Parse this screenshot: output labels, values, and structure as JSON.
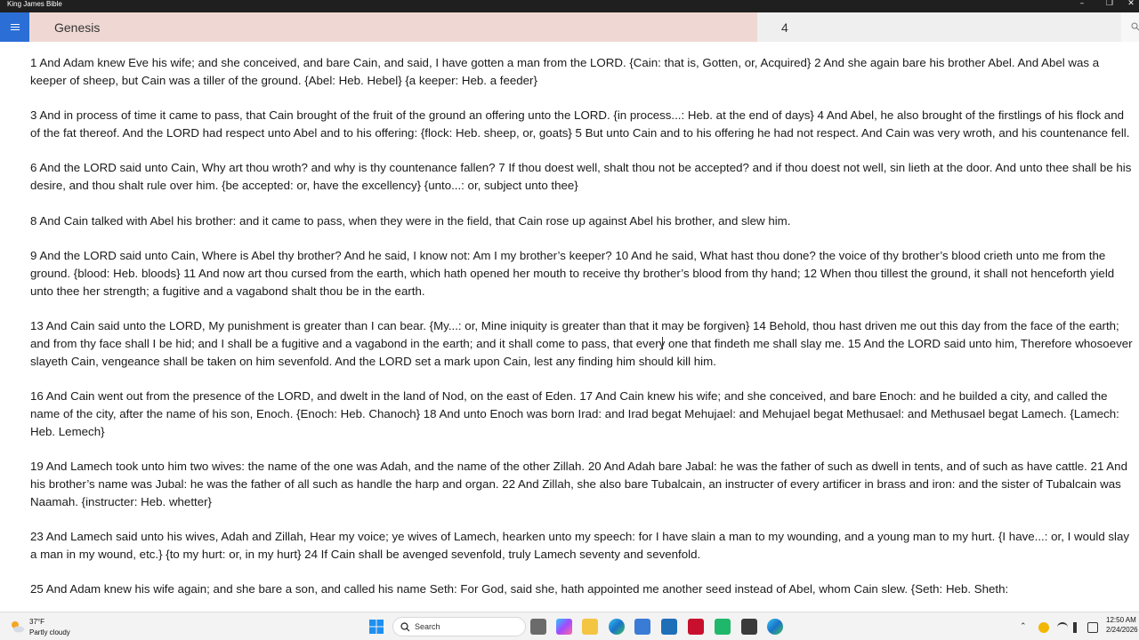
{
  "window": {
    "title": "King James Bible",
    "minimize": "–",
    "restore": "❐",
    "close": "✕"
  },
  "nav": {
    "menu_icon": "hamburger-menu-icon",
    "book": "Genesis",
    "chapter": "4",
    "search_icon": "search-icon"
  },
  "verses": [
    "1  And Adam knew Eve his wife; and she conceived, and bare Cain, and said, I have gotten a man from the LORD. {Cain: that is, Gotten, or, Acquired} 2  And she again bare his brother Abel. And Abel was a keeper of sheep, but Cain was a tiller of the ground. {Abel: Heb. Hebel} {a keeper: Heb. a feeder}",
    "3  And in process of time it came to pass, that Cain brought of the fruit of the ground an offering unto the LORD. {in process...: Heb. at the end of days} 4  And Abel, he also brought of the firstlings of his flock and of the fat thereof. And the LORD had respect unto Abel and to his offering: {flock: Heb. sheep, or, goats} 5  But unto Cain and to his offering he had not respect. And Cain was very wroth, and his countenance fell.",
    "6  And the LORD said unto Cain, Why art thou wroth? and why is thy countenance fallen? 7  If thou doest well, shalt thou not be accepted? and if thou doest not well, sin lieth at the door. And unto thee shall be his desire, and thou shalt rule over him. {be accepted: or, have the excellency} {unto...: or, subject unto thee}",
    "8  And Cain talked with Abel his brother: and it came to pass, when they were in the field, that Cain rose up against Abel his brother, and slew him.",
    "9  And the LORD said unto Cain, Where is Abel thy brother? And he said, I know not: Am I my brother’s keeper? 10  And he said, What hast thou done? the voice of thy brother’s blood crieth unto me from the ground. {blood: Heb. bloods} 11  And now art thou cursed from the earth, which hath opened her mouth to receive thy brother’s blood from thy hand; 12  When thou tillest the ground, it shall not henceforth yield unto thee her strength; a fugitive and a vagabond shalt thou be in the earth.",
    "13  And Cain said unto the LORD, My punishment is greater than I can bear. {My...: or, Mine iniquity is greater than that it may be forgiven} 14  Behold, thou hast driven me out this day from the face of the earth; and from thy face shall I be hid; and I shall be a fugitive and a vagabond in the earth; and it shall come to pass, that every one that findeth me shall slay me. 15  And the LORD said unto him, Therefore whosoever slayeth Cain, vengeance shall be taken on him sevenfold. And the LORD set a mark upon Cain, lest any finding him should kill him.",
    "16  And Cain went out from the presence of the LORD, and dwelt in the land of Nod, on the east of Eden. 17  And Cain knew his wife; and she conceived, and bare Enoch: and he builded a city, and called the name of the city, after the name of his son, Enoch. {Enoch: Heb. Chanoch} 18  And unto Enoch was born Irad: and Irad begat Mehujael: and Mehujael begat Methusael: and Methusael begat Lamech. {Lamech: Heb. Lemech}",
    "19  And Lamech took unto him two wives: the name of the one was Adah, and the name of the other Zillah. 20  And Adah bare Jabal: he was the father of such as dwell in tents, and of such as have cattle. 21  And his brother’s name was Jubal: he was the father of all such as handle the harp and organ. 22  And Zillah, she also bare Tubalcain, an instructer of every artificer in brass and iron: and the sister of Tubalcain was Naamah. {instructer: Heb. whetter}",
    "23  And Lamech said unto his wives, Adah and Zillah, Hear my voice; ye wives of Lamech, hearken unto my speech: for I have slain a man to my wounding, and a young man to my hurt. {I have...: or, I would slay a man in my wound, etc.} {to my hurt: or, in my hurt} 24  If Cain shall be avenged sevenfold, truly Lamech seventy and sevenfold.",
    "25  And Adam knew his wife again; and she bare a son, and called his name Seth: For God, said she, hath appointed me another seed instead of Abel, whom Cain slew. {Seth: Heb. Sheth:"
  ],
  "taskbar": {
    "weather_temp": "37°F",
    "weather_condition": "Partly cloudy",
    "search_placeholder": "Search",
    "time": "12:50 AM",
    "date": "2/24/2026",
    "colors": {
      "accent": "#2b6fd6",
      "book_field": "#efd8d3",
      "chapter_field": "#efefef"
    }
  }
}
